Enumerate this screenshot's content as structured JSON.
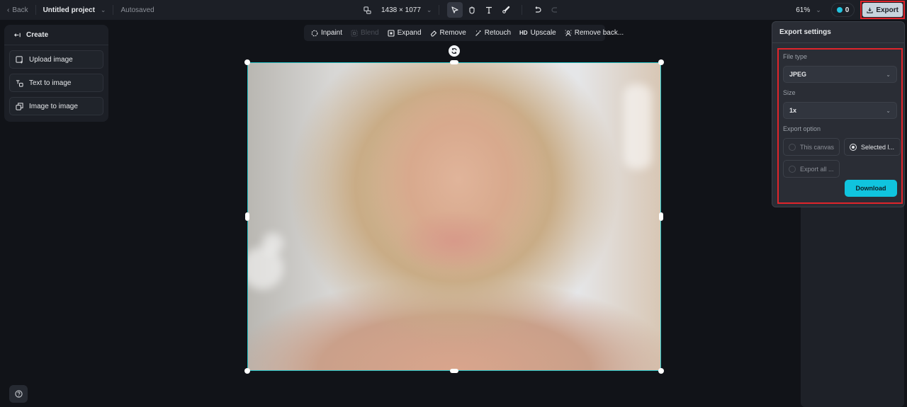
{
  "topbar": {
    "back_label": "Back",
    "project_name": "Untitled project",
    "save_status": "Autosaved",
    "canvas_size": "1438 × 1077",
    "zoom_level": "61%",
    "credits": "0",
    "export_label": "Export"
  },
  "tools": [
    {
      "name": "select",
      "icon": "cursor-icon",
      "active": true
    },
    {
      "name": "hand",
      "icon": "hand-icon",
      "active": false
    },
    {
      "name": "text",
      "icon": "text-icon",
      "active": false
    },
    {
      "name": "brush",
      "icon": "brush-icon",
      "active": false
    },
    {
      "name": "undo",
      "icon": "undo-icon",
      "active": false
    },
    {
      "name": "redo",
      "icon": "redo-icon",
      "active": false
    }
  ],
  "create_panel": {
    "title": "Create",
    "items": [
      {
        "label": "Upload image",
        "icon": "upload-image-icon"
      },
      {
        "label": "Text to image",
        "icon": "text-to-image-icon"
      },
      {
        "label": "Image to image",
        "icon": "image-to-image-icon"
      }
    ]
  },
  "edit_toolbar": {
    "items": [
      {
        "label": "Inpaint",
        "icon": "inpaint-icon",
        "disabled": false
      },
      {
        "label": "Blend",
        "icon": "blend-icon",
        "disabled": true
      },
      {
        "label": "Expand",
        "icon": "expand-icon",
        "disabled": false
      },
      {
        "label": "Remove",
        "icon": "eraser-icon",
        "disabled": false
      },
      {
        "label": "Retouch",
        "icon": "magic-wand-icon",
        "disabled": false
      },
      {
        "label": "Upscale",
        "icon": "hd-icon",
        "icon_text": "HD",
        "disabled": false
      },
      {
        "label": "Remove back...",
        "icon": "remove-background-icon",
        "disabled": false
      }
    ]
  },
  "export_settings": {
    "title": "Export settings",
    "file_type_label": "File type",
    "file_type_value": "JPEG",
    "size_label": "Size",
    "size_value": "1x",
    "export_option_label": "Export option",
    "options": [
      {
        "label": "This canvas",
        "selected": false
      },
      {
        "label": "Selected l...",
        "selected": true
      },
      {
        "label": "Export all ...",
        "selected": false
      }
    ],
    "download_label": "Download"
  },
  "colors": {
    "accent": "#10c4de",
    "selection": "#23bfc2",
    "highlight": "#e0242b"
  }
}
